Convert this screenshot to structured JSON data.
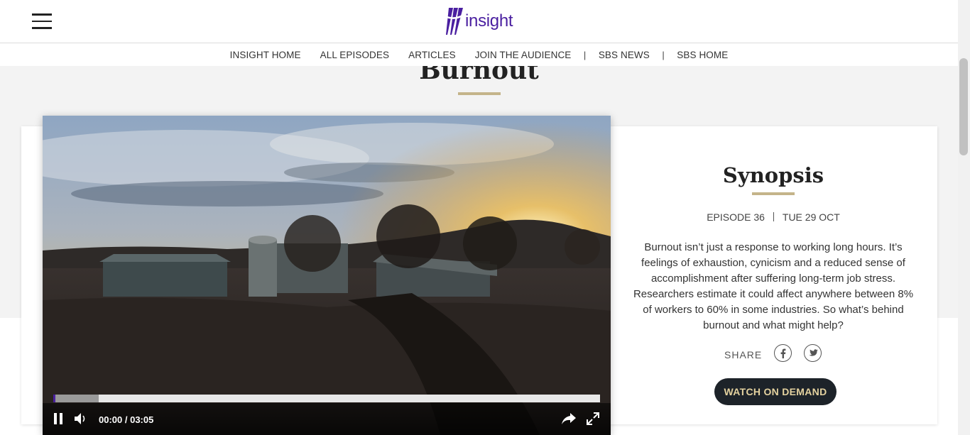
{
  "header": {
    "logo_text": "insight"
  },
  "nav": {
    "items": [
      {
        "label": "INSIGHT HOME"
      },
      {
        "label": "ALL EPISODES"
      },
      {
        "label": "ARTICLES"
      },
      {
        "label": "JOIN THE AUDIENCE"
      },
      {
        "label": "SBS NEWS"
      },
      {
        "label": "SBS HOME"
      }
    ],
    "separator": "|"
  },
  "page": {
    "title": "Burnout"
  },
  "video": {
    "time_display": "00:00 / 03:05",
    "current_time": "00:00",
    "duration": "03:05",
    "buffered_fraction": 0.083,
    "played_fraction": 0.0
  },
  "synopsis": {
    "title": "Synopsis",
    "episode": "EPISODE 36",
    "date": "TUE 29 OCT",
    "description": "Burnout isn’t just a response to working long hours. It’s feelings of exhaustion, cynicism and a reduced sense of accomplishment after suffering long-term job stress. Researchers estimate it could affect anywhere between 8% of workers to 60% in some industries. So what’s behind burnout and what might help?",
    "share_label": "SHARE",
    "watch_label": "WATCH ON DEMAND"
  },
  "colors": {
    "brand_purple": "#4a1fa0",
    "accent_gold": "#c4b48a",
    "button_dark": "#1d2329"
  }
}
